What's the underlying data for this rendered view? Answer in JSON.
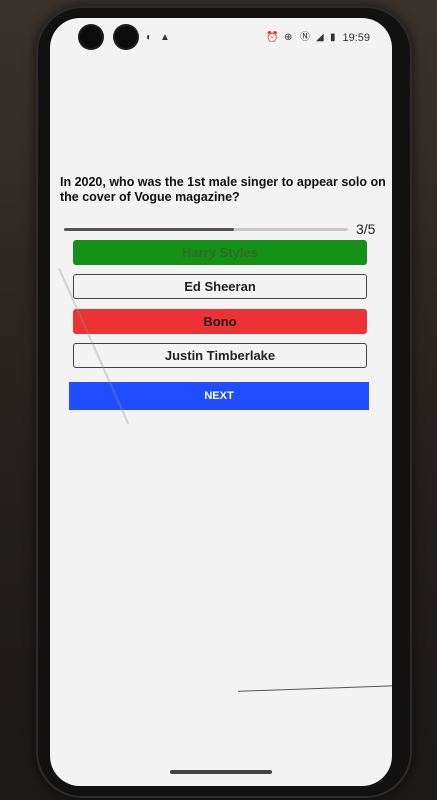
{
  "status_bar": {
    "left_icons": [
      "app-notification-icon",
      "warning-icon"
    ],
    "right_icons": [
      "alarm-icon",
      "data-saver-icon",
      "nfc-icon",
      "signal-icon",
      "battery-icon"
    ],
    "time": "19:59"
  },
  "quiz": {
    "question": "In 2020, who was the 1st male singer to appear solo on the cover of Vogue magazine?",
    "progress_current": 3,
    "progress_total": 5,
    "progress_text": "3/5",
    "answers": [
      {
        "label": "Harry Styles",
        "state": "correct"
      },
      {
        "label": "Ed Sheeran",
        "state": "neutral"
      },
      {
        "label": "Bono",
        "state": "wrong"
      },
      {
        "label": "Justin Timberlake",
        "state": "neutral"
      }
    ],
    "next_label": "NEXT"
  },
  "colors": {
    "correct": "#169117",
    "wrong": "#ec3232",
    "next_button": "#1f4dff"
  }
}
